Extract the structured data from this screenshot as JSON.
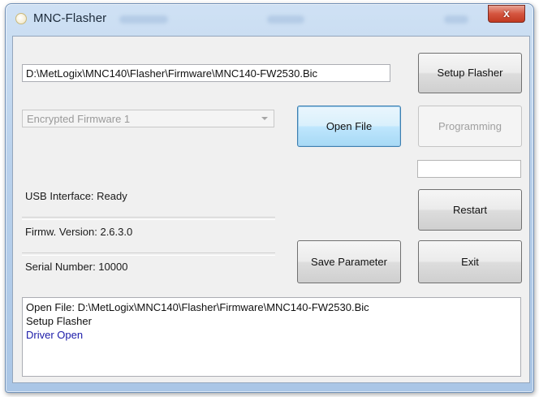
{
  "window": {
    "title": "MNC-Flasher",
    "close_symbol": "x"
  },
  "firmware_path": "D:\\MetLogix\\MNC140\\Flasher\\Firmware\\MNC140-FW2530.Bic",
  "firmware_select": {
    "selected": "Encrypted Firmware 1"
  },
  "buttons": {
    "setup_flasher": "Setup Flasher",
    "open_file": "Open File",
    "programming": "Programming",
    "restart": "Restart",
    "save_parameter": "Save Parameter",
    "exit": "Exit"
  },
  "status": {
    "usb_interface": "USB Interface: Ready",
    "firmware_version": "Firmw. Version: 2.6.3.0",
    "serial_number": "Serial Number: 10000"
  },
  "log": [
    "Open File: D:\\MetLogix\\MNC140\\Flasher\\Firmware\\MNC140-FW2530.Bic",
    "Setup Flasher",
    "Driver Open"
  ],
  "colors": {
    "log_highlight": "#1a1aa8"
  },
  "icons": {
    "app": "circle-app-icon",
    "close": "close-icon",
    "dropdown": "chevron-down-icon"
  }
}
